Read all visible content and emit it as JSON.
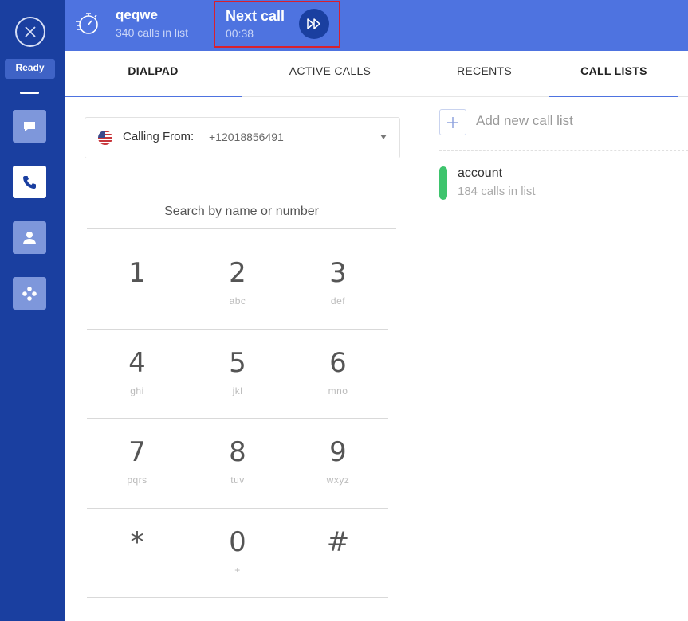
{
  "sidebar": {
    "status": "Ready",
    "icons": [
      "close-icon",
      "chat-icon",
      "phone-icon",
      "contact-icon",
      "apps-icon"
    ]
  },
  "header": {
    "list_name": "qeqwe",
    "list_count": "340 calls in list",
    "next_call_label": "Next call",
    "next_call_timer": "00:38"
  },
  "tabs": {
    "dialpad": "DIALPAD",
    "active_calls": "ACTIVE CALLS",
    "recents": "RECENTS",
    "call_lists": "CALL LISTS"
  },
  "dialer": {
    "calling_from_label": "Calling From:",
    "calling_from_number": "+12018856491",
    "search_placeholder": "Search by name or number"
  },
  "keypad": [
    {
      "digit": "1",
      "letters": ""
    },
    {
      "digit": "2",
      "letters": "abc"
    },
    {
      "digit": "3",
      "letters": "def"
    },
    {
      "digit": "4",
      "letters": "ghi"
    },
    {
      "digit": "5",
      "letters": "jkl"
    },
    {
      "digit": "6",
      "letters": "mno"
    },
    {
      "digit": "7",
      "letters": "pqrs"
    },
    {
      "digit": "8",
      "letters": "tuv"
    },
    {
      "digit": "9",
      "letters": "wxyz"
    },
    {
      "digit": "*",
      "letters": ""
    },
    {
      "digit": "0",
      "letters": "+"
    },
    {
      "digit": "#",
      "letters": ""
    }
  ],
  "call_lists": {
    "add_label": "Add new call list",
    "items": [
      {
        "name": "account",
        "count": "184 calls in list",
        "color": "#3ec46d"
      }
    ]
  },
  "colors": {
    "sidebar": "#1a3fa0",
    "header": "#4e73e0",
    "highlight_border": "#d8202e"
  }
}
